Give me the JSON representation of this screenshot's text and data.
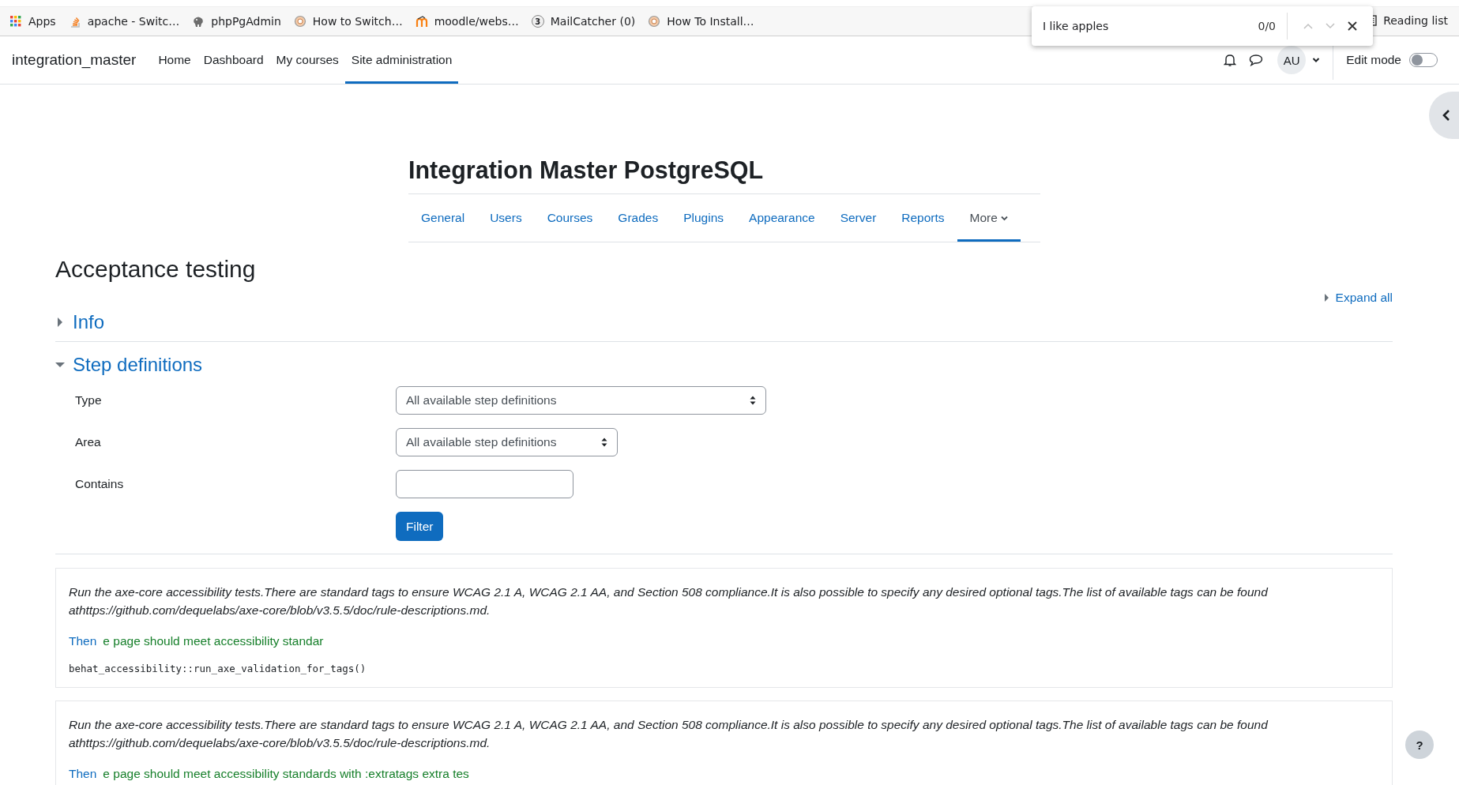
{
  "bookmarks_bar": {
    "items": [
      {
        "kind": "apps",
        "label": "Apps"
      },
      {
        "kind": "stack",
        "label": "apache - Switc…"
      },
      {
        "kind": "elephant",
        "label": "phpPgAdmin"
      },
      {
        "kind": "globe",
        "label": "How to Switch…"
      },
      {
        "kind": "moodle",
        "label": "moodle/webs…"
      },
      {
        "kind": "badge",
        "badge": "3",
        "label": "MailCatcher (0)"
      },
      {
        "kind": "globe",
        "label": "How To Install…"
      }
    ],
    "reading_list": "Reading list"
  },
  "find_bar": {
    "value": "I like apples",
    "count": "0/0"
  },
  "navbar": {
    "site_name": "integration_master",
    "items": [
      {
        "label": "Home",
        "selected": false
      },
      {
        "label": "Dashboard",
        "selected": false
      },
      {
        "label": "My courses",
        "selected": false
      },
      {
        "label": "Site administration",
        "selected": true
      }
    ],
    "avatar": "AU",
    "edit_mode": {
      "label": "Edit mode",
      "on": false
    }
  },
  "page_header": {
    "title": "Integration Master PostgreSQL",
    "tabs": [
      {
        "label": "General",
        "selected": false
      },
      {
        "label": "Users",
        "selected": false
      },
      {
        "label": "Courses",
        "selected": false
      },
      {
        "label": "Grades",
        "selected": false
      },
      {
        "label": "Plugins",
        "selected": false
      },
      {
        "label": "Appearance",
        "selected": false
      },
      {
        "label": "Server",
        "selected": false
      },
      {
        "label": "Reports",
        "selected": false
      },
      {
        "label": "More",
        "selected": true,
        "kind": "dropdown"
      }
    ]
  },
  "heading": "Acceptance testing",
  "expand_all": "Expand all",
  "sections": [
    {
      "title": "Info",
      "expanded": false
    },
    {
      "title": "Step definitions",
      "expanded": true
    }
  ],
  "form": {
    "fields": [
      {
        "kind": "select",
        "label": "Type",
        "value": "All available step definitions"
      },
      {
        "kind": "select",
        "label": "Area",
        "value": "All available step definitions"
      },
      {
        "kind": "text",
        "label": "Contains"
      }
    ],
    "button": "Filter"
  },
  "steps": [
    {
      "description": "Run the axe-core accessibility tests.There are standard tags to ensure WCAG 2.1 A, WCAG 2.1 AA, and Section 508 compliance.It is also possible to specify any desired optional tags.The list of available tags can be found athttps://github.com/dequelabs/axe-core/blob/v3.5.5/doc/rule-descriptions.md.",
      "keyword": "Then",
      "text": "e page should meet accessibility standar",
      "code": "behat_accessibility::run_axe_validation_for_tags()"
    },
    {
      "description": "Run the axe-core accessibility tests.There are standard tags to ensure WCAG 2.1 A, WCAG 2.1 AA, and Section 508 compliance.It is also possible to specify any desired optional tags.The list of available tags can be found athttps://github.com/dequelabs/axe-core/blob/v3.5.5/doc/rule-descriptions.md.",
      "keyword": "Then",
      "text": "e page should meet accessibility standards with :extratags extra tes"
    }
  ],
  "help_button": "?"
}
